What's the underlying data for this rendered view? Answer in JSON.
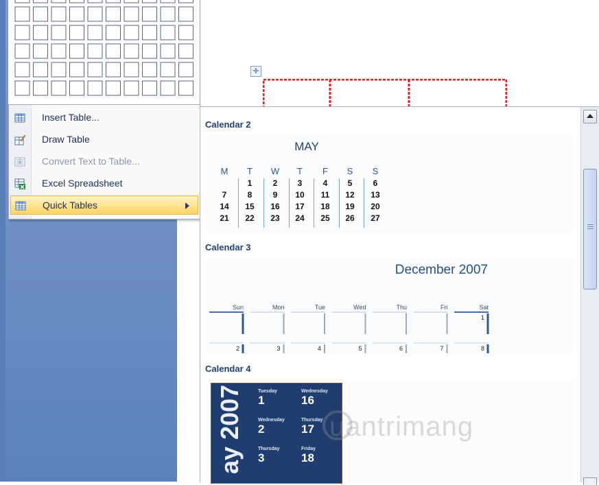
{
  "menu": {
    "items": [
      {
        "label": "Insert Table...",
        "icon": "insert-table-icon",
        "disabled": false
      },
      {
        "label": "Draw Table",
        "icon": "draw-table-icon",
        "disabled": false
      },
      {
        "label": "Convert Text to Table...",
        "icon": "convert-text-icon",
        "disabled": true
      },
      {
        "label": "Excel Spreadsheet",
        "icon": "excel-icon",
        "disabled": false
      },
      {
        "label": "Quick Tables",
        "icon": "quick-tables-icon",
        "disabled": false,
        "highlighted": true,
        "submenu": true
      }
    ]
  },
  "gallery": {
    "sections": [
      {
        "title": "Calendar 2"
      },
      {
        "title": "Calendar 3"
      },
      {
        "title": "Calendar 4"
      }
    ]
  },
  "calendar2": {
    "month": "MAY",
    "days": [
      "M",
      "T",
      "W",
      "T",
      "F",
      "S",
      "S"
    ],
    "weeks": [
      [
        "",
        "1",
        "2",
        "3",
        "4",
        "5",
        "6"
      ],
      [
        "7",
        "8",
        "9",
        "10",
        "11",
        "12",
        "13"
      ],
      [
        "14",
        "15",
        "16",
        "17",
        "18",
        "19",
        "20"
      ],
      [
        "21",
        "22",
        "23",
        "24",
        "25",
        "26",
        "27"
      ]
    ]
  },
  "calendar3": {
    "title": "December 2007",
    "days": [
      "Sun",
      "Mon",
      "Tue",
      "Wed",
      "Thu",
      "Fri",
      "Sat"
    ],
    "row1": [
      "",
      "",
      "",
      "",
      "",
      "",
      "1"
    ],
    "row2": [
      "2",
      "3",
      "4",
      "5",
      "6",
      "7",
      "8"
    ]
  },
  "calendar4": {
    "vertical_text": "ay 2007",
    "columns": [
      {
        "entries": [
          {
            "day": "Tuesday",
            "num": "1"
          },
          {
            "day": "Wednesday",
            "num": "2"
          },
          {
            "day": "Thursday",
            "num": "3"
          }
        ]
      },
      {
        "entries": [
          {
            "day": "Wednesday",
            "num": "16"
          },
          {
            "day": "Thursday",
            "num": "17"
          },
          {
            "day": "Friday",
            "num": "18"
          }
        ]
      }
    ]
  },
  "watermark": "uantrimang",
  "colors": {
    "accent": "#1f3f6f",
    "highlight": "#ffe493",
    "table_border": "#e02020",
    "doc_bg": "#6f90c4"
  }
}
